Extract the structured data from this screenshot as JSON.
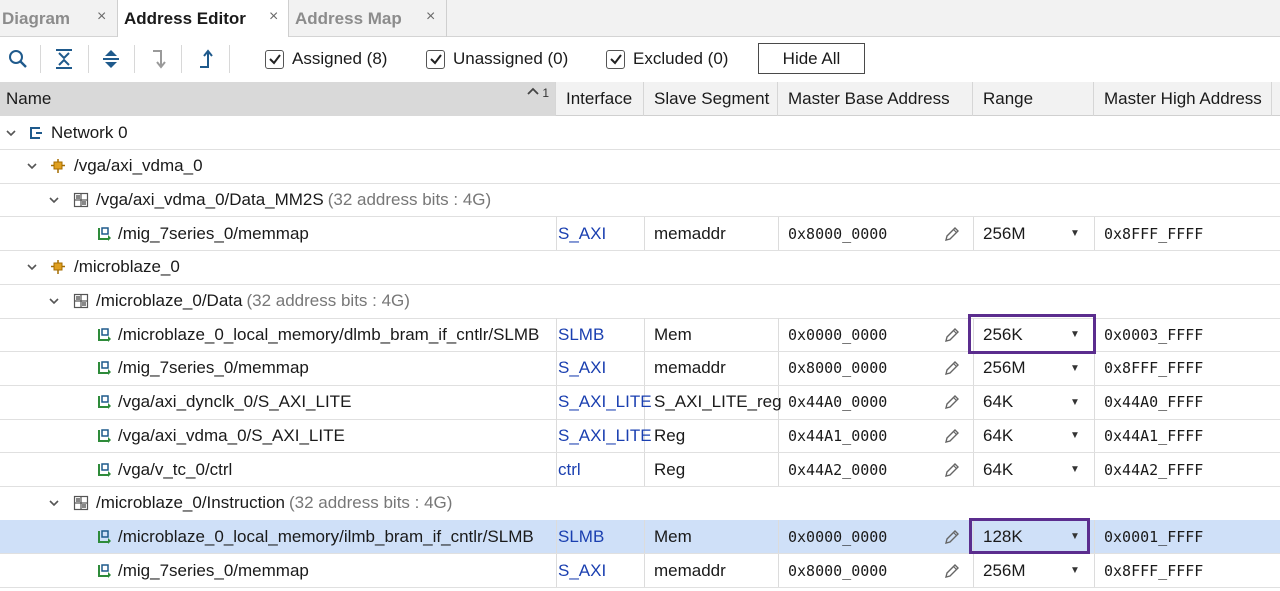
{
  "tabs": [
    {
      "label": "Diagram",
      "close": "×"
    },
    {
      "label": "Address Editor",
      "close": "×"
    },
    {
      "label": "Address Map",
      "close": "×"
    }
  ],
  "toolbar": {
    "icons": [
      "search-icon",
      "collapse-all-icon",
      "expand-all-icon",
      "auto-assign-icon",
      "export-icon"
    ],
    "assigned": "Assigned (8)",
    "unassigned": "Unassigned (0)",
    "excluded": "Excluded (0)",
    "hide_all": "Hide All"
  },
  "columns": {
    "name": "Name",
    "sort_index": "1",
    "interface": "Interface",
    "slave_segment": "Slave Segment",
    "master_base": "Master Base Address",
    "range": "Range",
    "master_high": "Master High Address"
  },
  "rows": [
    {
      "type": "network",
      "label": "Network 0"
    },
    {
      "type": "master",
      "label": "/vga/axi_vdma_0"
    },
    {
      "type": "space",
      "label": "/vga/axi_vdma_0/Data_MM2S",
      "suffix": "(32 address bits : 4G)"
    },
    {
      "type": "seg",
      "label": "/mig_7series_0/memmap",
      "interface": "S_AXI",
      "segment": "memaddr",
      "base": "0x8000_0000",
      "range": "256M",
      "high": "0x8FFF_FFFF"
    },
    {
      "type": "master",
      "label": "/microblaze_0"
    },
    {
      "type": "space",
      "label": "/microblaze_0/Data",
      "suffix": "(32 address bits : 4G)"
    },
    {
      "type": "seg",
      "label": "/microblaze_0_local_memory/dlmb_bram_if_cntlr/SLMB",
      "interface": "SLMB",
      "segment": "Mem",
      "base": "0x0000_0000",
      "range": "256K",
      "high": "0x0003_FFFF"
    },
    {
      "type": "seg",
      "label": "/mig_7series_0/memmap",
      "interface": "S_AXI",
      "segment": "memaddr",
      "base": "0x8000_0000",
      "range": "256M",
      "high": "0x8FFF_FFFF"
    },
    {
      "type": "seg",
      "label": "/vga/axi_dynclk_0/S_AXI_LITE",
      "interface": "S_AXI_LITE",
      "segment": "S_AXI_LITE_reg",
      "base": "0x44A0_0000",
      "range": "64K",
      "high": "0x44A0_FFFF"
    },
    {
      "type": "seg",
      "label": "/vga/axi_vdma_0/S_AXI_LITE",
      "interface": "S_AXI_LITE",
      "segment": "Reg",
      "base": "0x44A1_0000",
      "range": "64K",
      "high": "0x44A1_FFFF"
    },
    {
      "type": "seg",
      "label": "/vga/v_tc_0/ctrl",
      "interface": "ctrl",
      "segment": "Reg",
      "base": "0x44A2_0000",
      "range": "64K",
      "high": "0x44A2_FFFF"
    },
    {
      "type": "space",
      "label": "/microblaze_0/Instruction",
      "suffix": "(32 address bits : 4G)"
    },
    {
      "type": "seg",
      "label": "/microblaze_0_local_memory/ilmb_bram_if_cntlr/SLMB",
      "interface": "SLMB",
      "segment": "Mem",
      "base": "0x0000_0000",
      "range": "128K",
      "high": "0x0001_FFFF",
      "selected": true
    },
    {
      "type": "seg",
      "label": "/mig_7series_0/memmap",
      "interface": "S_AXI",
      "segment": "memaddr",
      "base": "0x8000_0000",
      "range": "256M",
      "high": "0x8FFF_FFFF"
    }
  ],
  "colors": {
    "selected_row": "#cfe0f8",
    "highlight_box": "#5b2d8e",
    "interface_link": "#1a3fb0",
    "master_icon": "#e0a020",
    "segment_icon": "#2e8b3a"
  }
}
